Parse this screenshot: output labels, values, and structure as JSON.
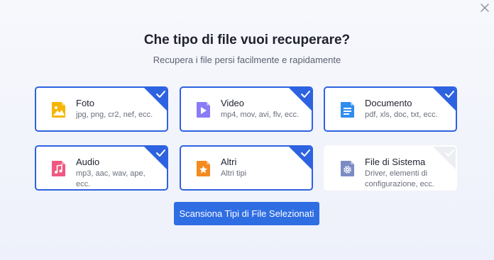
{
  "dialog": {
    "title": "Che tipo di file vuoi recuperare?",
    "subtitle": "Recupera i file persi facilmente e rapidamente",
    "scan_label": "Scansiona Tipi di File Selezionati"
  },
  "categories": [
    {
      "title": "Foto",
      "desc": "jpg, png, cr2, nef, ecc.",
      "icon": "image-icon",
      "selected": true,
      "color": "#f7b500"
    },
    {
      "title": "Video",
      "desc": "mp4, mov, avi, flv, ecc.",
      "icon": "video-icon",
      "selected": true,
      "color": "#8a7cf7"
    },
    {
      "title": "Documento",
      "desc": "pdf, xls, doc, txt, ecc.",
      "icon": "document-icon",
      "selected": true,
      "color": "#2f8cf0"
    },
    {
      "title": "Audio",
      "desc": "mp3, aac, wav, ape, ecc.",
      "icon": "music-icon",
      "selected": true,
      "color": "#f0587f"
    },
    {
      "title": "Altri",
      "desc": "Altri tipi",
      "icon": "star-file-icon",
      "selected": true,
      "color": "#f58a1f"
    },
    {
      "title": "File di Sistema",
      "desc": "Driver, elementi di configurazione, ecc.",
      "icon": "gear-file-icon",
      "selected": false,
      "color": "#7c8bc4"
    }
  ],
  "colors": {
    "accent": "#2d62e1",
    "button": "#2f6de3"
  }
}
